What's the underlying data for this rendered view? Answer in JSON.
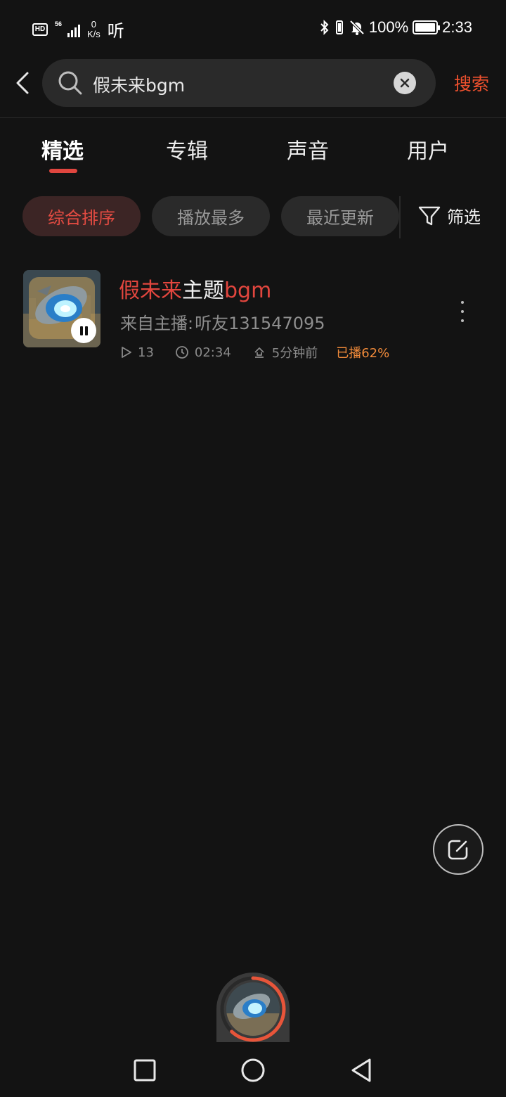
{
  "status_bar": {
    "hd": "HD",
    "network": "56",
    "speed_value": "0",
    "speed_unit": "K/s",
    "app_glyph": "听",
    "battery_pct": "100%",
    "time": "2:33",
    "icons": [
      "bluetooth-icon",
      "vibrate-icon",
      "mute-bell-icon",
      "battery-icon"
    ]
  },
  "header": {
    "search_query": "假未来bgm",
    "search_button": "搜索",
    "accent_color": "#f0512e"
  },
  "tabs": [
    {
      "label": "精选",
      "active": true
    },
    {
      "label": "专辑",
      "active": false
    },
    {
      "label": "声音",
      "active": false
    },
    {
      "label": "用户",
      "active": false
    }
  ],
  "filters": {
    "chips": [
      {
        "label": "综合排序",
        "active": true
      },
      {
        "label": "播放最多",
        "active": false
      },
      {
        "label": "最近更新",
        "active": false
      }
    ],
    "filter_label": "筛选"
  },
  "results": [
    {
      "title_parts": [
        {
          "text": "假未来",
          "highlight": true
        },
        {
          "text": "主题",
          "highlight": false
        },
        {
          "text": "bgm",
          "highlight": true
        }
      ],
      "author_prefix": "来自主播:",
      "author_name": "听友131547095",
      "plays": "13",
      "duration": "02:34",
      "uploaded": "5分钟前",
      "progress_text": "已播62%",
      "playing": true
    }
  ],
  "mini_player": {
    "progress": 0.62,
    "accent_color": "#e8553a"
  },
  "colors": {
    "background": "#131313",
    "highlight": "#e2463e",
    "chip_active_bg": "#3c2525",
    "progress_text": "#f08a3a"
  }
}
